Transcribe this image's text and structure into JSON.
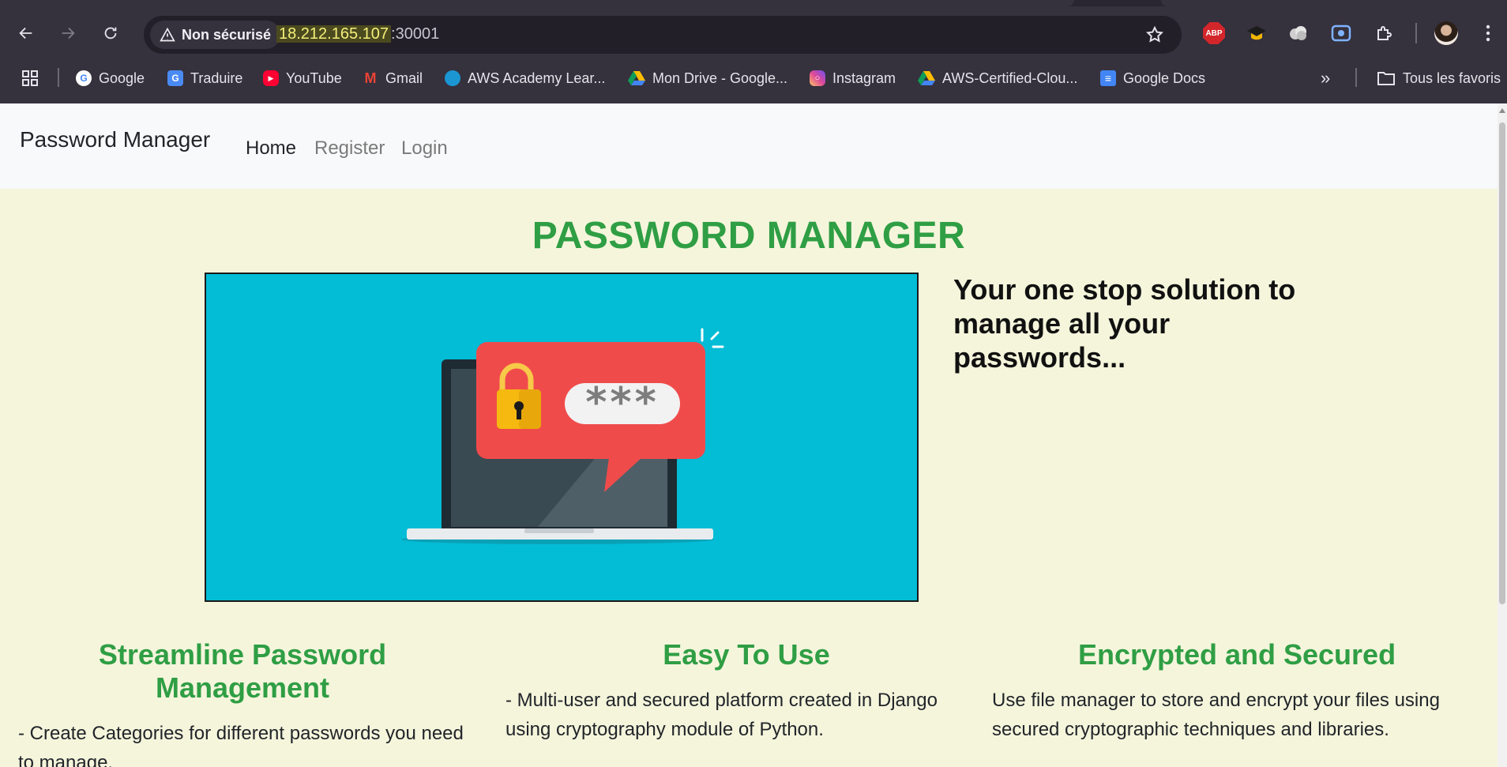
{
  "browser": {
    "security_label": "Non sécurisé",
    "url_host": "18.212.165.107",
    "url_port": ":30001",
    "bookmarks": [
      {
        "label": "Google",
        "icon": "google-icon"
      },
      {
        "label": "Traduire",
        "icon": "translate-icon"
      },
      {
        "label": "YouTube",
        "icon": "youtube-icon"
      },
      {
        "label": "Gmail",
        "icon": "gmail-icon"
      },
      {
        "label": "AWS Academy Lear...",
        "icon": "salesforce-cloud-icon"
      },
      {
        "label": "Mon Drive - Google...",
        "icon": "google-drive-icon"
      },
      {
        "label": "Instagram",
        "icon": "instagram-icon"
      },
      {
        "label": "AWS-Certified-Clou...",
        "icon": "google-drive-icon"
      },
      {
        "label": "Google Docs",
        "icon": "google-docs-icon"
      }
    ],
    "all_bookmarks_label": "Tous les favoris",
    "abp_label": "ABP"
  },
  "site": {
    "brand": "Password Manager",
    "nav": [
      {
        "label": "Home",
        "active": true
      },
      {
        "label": "Register",
        "active": false
      },
      {
        "label": "Login",
        "active": false
      }
    ],
    "hero_title": "PASSWORD MANAGER",
    "tagline": "Your one stop solution to manage all your passwords...",
    "image_password_mask": "***",
    "features": [
      {
        "title": "Streamline Password Management",
        "text": "- Create Categories for different passwords you need to manage."
      },
      {
        "title": "Easy To Use",
        "text": "- Multi-user and secured platform created in Django using cryptography module of Python."
      },
      {
        "title": "Encrypted and Secured",
        "text": "Use file manager to store and encrypt your files using secured cryptographic techniques and libraries."
      }
    ]
  },
  "colors": {
    "accent_green": "#2f9e44",
    "page_bg": "#f5f5dc",
    "hero_bg": "#03bcd6",
    "bubble_red": "#f04b4b",
    "lock_yellow": "#f5b90f"
  }
}
